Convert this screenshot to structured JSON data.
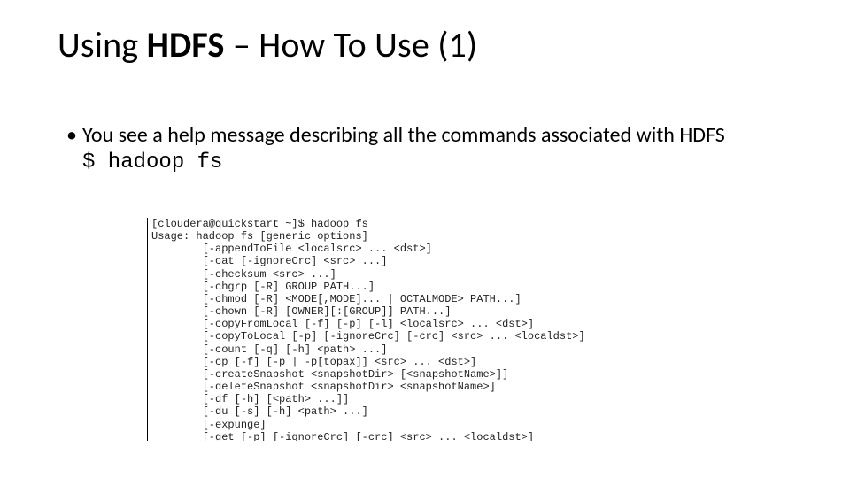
{
  "title": {
    "part1": "Using ",
    "bold": "HDFS",
    "part2": " – How To Use (1)"
  },
  "bullet": {
    "text": "You see a help message describing all the commands associated with HDFS",
    "command": "$ hadoop fs"
  },
  "terminal": {
    "text": "[cloudera@quickstart ~]$ hadoop fs\nUsage: hadoop fs [generic options]\n        [-appendToFile <localsrc> ... <dst>]\n        [-cat [-ignoreCrc] <src> ...]\n        [-checksum <src> ...]\n        [-chgrp [-R] GROUP PATH...]\n        [-chmod [-R] <MODE[,MODE]... | OCTALMODE> PATH...]\n        [-chown [-R] [OWNER][:[GROUP]] PATH...]\n        [-copyFromLocal [-f] [-p] [-l] <localsrc> ... <dst>]\n        [-copyToLocal [-p] [-ignoreCrc] [-crc] <src> ... <localdst>]\n        [-count [-q] [-h] <path> ...]\n        [-cp [-f] [-p | -p[topax]] <src> ... <dst>]\n        [-createSnapshot <snapshotDir> [<snapshotName>]]\n        [-deleteSnapshot <snapshotDir> <snapshotName>]\n        [-df [-h] [<path> ...]]\n        [-du [-s] [-h] <path> ...]\n        [-expunge]\n        [-get [-p] [-ignoreCrc] [-crc] <src> ... <localdst>]\n        [-getfacl [-R] <path>]"
  }
}
